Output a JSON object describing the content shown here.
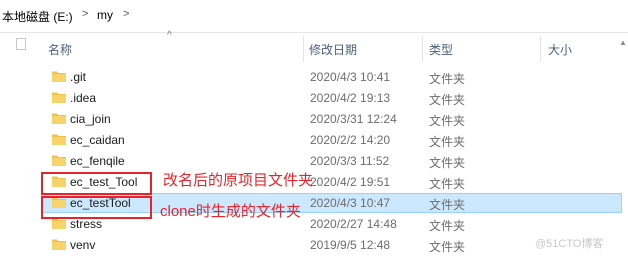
{
  "breadcrumb": {
    "drive": "本地磁盘 (E:)",
    "folder": "my",
    "separator": ">"
  },
  "columns": {
    "name": "名称",
    "date": "修改日期",
    "type": "类型",
    "size": "大小"
  },
  "rows": [
    {
      "name": ".git",
      "date": "2020/4/3 10:41",
      "type": "文件夹"
    },
    {
      "name": ".idea",
      "date": "2020/4/2 19:13",
      "type": "文件夹"
    },
    {
      "name": "cia_join",
      "date": "2020/3/31 12:24",
      "type": "文件夹"
    },
    {
      "name": "ec_caidan",
      "date": "2020/2/2 14:20",
      "type": "文件夹"
    },
    {
      "name": "ec_fenqile",
      "date": "2020/3/3 11:52",
      "type": "文件夹"
    },
    {
      "name": "ec_test_Tool",
      "date": "2020/4/2 19:51",
      "type": "文件夹"
    },
    {
      "name": "ec_testTool",
      "date": "2020/4/3 10:47",
      "type": "文件夹"
    },
    {
      "name": "stress",
      "date": "2020/2/27 14:48",
      "type": "文件夹"
    },
    {
      "name": "venv",
      "date": "2019/9/5 12:48",
      "type": "文件夹"
    }
  ],
  "selected_row": "ec_testTool",
  "annotations": {
    "renamed": "改名后的原项目文件夹",
    "cloned": "clone时生成的文件夹"
  },
  "watermark": "@51CTO博客",
  "colors": {
    "folder": "#f0c14b",
    "selection": "#cce8ff",
    "annotation": "#e8232a"
  }
}
